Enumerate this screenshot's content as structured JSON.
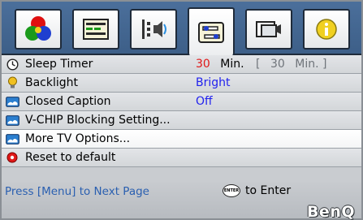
{
  "tabs": [
    {
      "icon": "color-picture-icon",
      "active": false
    },
    {
      "icon": "display-settings-icon",
      "active": false
    },
    {
      "icon": "audio-speaker-icon",
      "active": false
    },
    {
      "icon": "setup-switches-icon",
      "active": true
    },
    {
      "icon": "input-source-icon",
      "active": false
    },
    {
      "icon": "information-icon",
      "active": false
    }
  ],
  "menu": {
    "sleep_timer": {
      "label": "Sleep Timer",
      "value": "30",
      "unit": "Min.",
      "bracket_open": "[",
      "bracket_value": "30",
      "bracket_unit": "Min. ]"
    },
    "backlight": {
      "label": "Backlight",
      "value": "Bright"
    },
    "closed_caption": {
      "label": "Closed Caption",
      "value": "Off"
    },
    "vchip": {
      "label": "V-CHIP Blocking Setting..."
    },
    "more_tv": {
      "label": "More TV Options..."
    },
    "reset": {
      "label": "Reset to default"
    }
  },
  "footer": {
    "hint": "Press [Menu] to Next Page",
    "enter_button": "ENTER",
    "enter_text": "to Enter",
    "brand": "BenQ"
  },
  "colors": {
    "value_blue": "#2222ee",
    "value_red": "#e01818",
    "hint_blue": "#2a5fb0"
  }
}
